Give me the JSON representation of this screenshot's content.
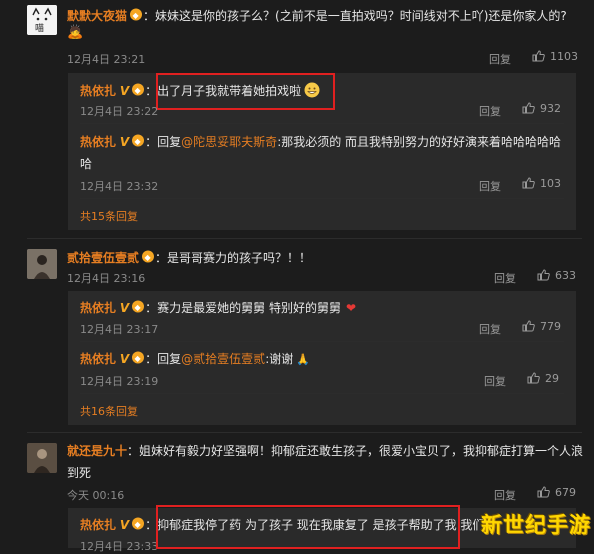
{
  "comments": [
    {
      "user": "默默大夜猫",
      "text": "妹妹这是你的孩子么？(之前不是一直拍戏吗？时间线对不上吖)还是你家人的?",
      "date": "12月4日 23:21",
      "reply_label": "回复",
      "likes": "1103",
      "emoji": "🙇"
    },
    {
      "user": "贰拾壹伍壹贰",
      "text": "是哥哥赛力的孩子吗？！！",
      "date": "12月4日 23:16",
      "reply_label": "回复",
      "likes": "633"
    },
    {
      "user": "就还是九十",
      "text_line1": "姐妹好有毅力好坚强啊！抑郁症还敢生孩子，很爱小宝贝了，我抑郁症打算一个人浪",
      "text_line2": "到死",
      "date": "今天 00:16",
      "reply_label": "回复",
      "likes": "679"
    }
  ],
  "replies_block1": [
    {
      "user": "热依扎",
      "text": "出了月子我就带着她拍戏啦",
      "date": "12月4日 23:22",
      "reply_label": "回复",
      "likes": "932"
    },
    {
      "user": "热依扎",
      "prefix": "回复",
      "mention": "@陀思妥耶夫斯奇",
      "text_line1": ":那我必须的 而且我特别努力的好好演来着哈哈哈哈哈",
      "text_line2": "哈",
      "date": "12月4日 23:32",
      "reply_label": "回复",
      "likes": "103"
    }
  ],
  "more_block1": "共15条回复",
  "replies_block2": [
    {
      "user": "热依扎",
      "text": "赛力是最爱她的舅舅 特别好的舅舅",
      "date": "12月4日 23:17",
      "reply_label": "回复",
      "likes": "779"
    },
    {
      "user": "热依扎",
      "prefix": "回复",
      "mention": "@贰拾壹伍壹贰",
      "text": ":谢谢",
      "date": "12月4日 23:19",
      "reply_label": "回复",
      "likes": "29"
    }
  ],
  "more_block2": "共16条回复",
  "replies_block3": [
    {
      "user": "热依扎",
      "text": "抑郁症我停了药 为了孩子 现在我康复了 是孩子帮助了我 我们",
      "date_partial": "12月4日 23:33"
    }
  ],
  "watermark": "新世纪手游",
  "verified_mark": "V",
  "colors": {
    "background": "#1c1c1c",
    "reply_bg": "#2a2a2a",
    "username": "#e67e22",
    "highlight_box": "#e02020"
  }
}
